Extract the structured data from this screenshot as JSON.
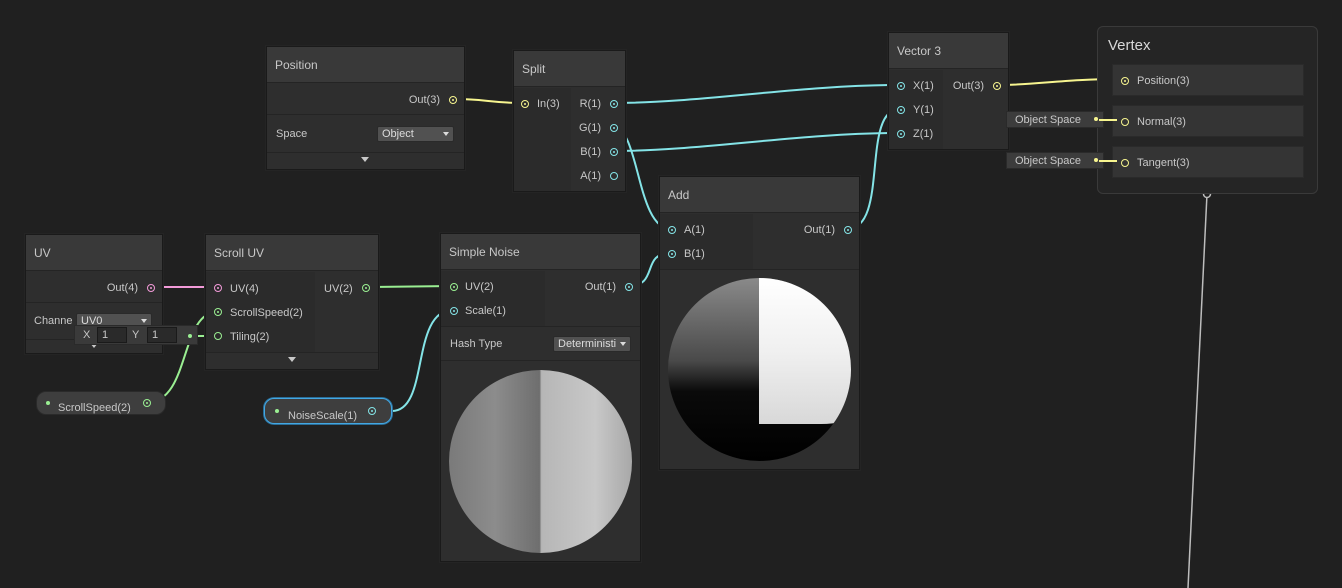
{
  "colors": {
    "vector3": "#f7f58f",
    "vector4": "#f29ad8",
    "vector2": "#9aef92",
    "vector1": "#84e4e7",
    "background": "#202020",
    "selection": "#44a7e2"
  },
  "position_node": {
    "title": "Position",
    "out_label": "Out(3)",
    "space_label": "Space",
    "space_value": "Object"
  },
  "split_node": {
    "title": "Split",
    "in_label": "In(3)",
    "outputs": [
      "R(1)",
      "G(1)",
      "B(1)",
      "A(1)"
    ]
  },
  "vector3_node": {
    "title": "Vector 3",
    "inputs": [
      "X(1)",
      "Y(1)",
      "Z(1)"
    ],
    "out_label": "Out(3)"
  },
  "vertex_node": {
    "title": "Vertex",
    "slots": [
      "Position(3)",
      "Normal(3)",
      "Tangent(3)"
    ],
    "normal_space": "Object Space",
    "tangent_space": "Object Space"
  },
  "uv_node": {
    "title": "UV",
    "out_label": "Out(4)",
    "channel_label": "Channe",
    "channel_value": "UV0"
  },
  "scroll_uv_node": {
    "title": "Scroll UV",
    "inputs": [
      "UV(4)",
      "ScrollSpeed(2)",
      "Tiling(2)"
    ],
    "out_label": "UV(2)",
    "tiling_x_label": "X",
    "tiling_x": "1",
    "tiling_y_label": "Y",
    "tiling_y": "1"
  },
  "simple_noise_node": {
    "title": "Simple Noise",
    "inputs": [
      "UV(2)",
      "Scale(1)"
    ],
    "out_label": "Out(1)",
    "hash_label": "Hash Type",
    "hash_value": "Deterministi"
  },
  "add_node": {
    "title": "Add",
    "inputs": [
      "A(1)",
      "B(1)"
    ],
    "out_label": "Out(1)"
  },
  "properties": {
    "scroll_speed": "ScrollSpeed(2)",
    "noise_scale": "NoiseScale(1)"
  }
}
